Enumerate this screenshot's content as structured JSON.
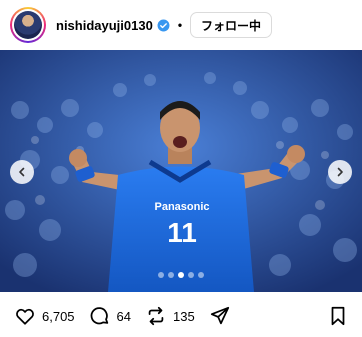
{
  "post": {
    "username": "nishidayuji0130",
    "separator": "•",
    "follow_label": "フォロー中"
  },
  "photo": {
    "jersey_brand": "Panasonic",
    "jersey_number": "11",
    "carousel_total": 5,
    "carousel_active": 3
  },
  "actions": {
    "likes": "6,705",
    "comments": "64",
    "reposts": "135"
  },
  "colors": {
    "verified": "#3897f0",
    "jersey": "#1f6fe0"
  }
}
